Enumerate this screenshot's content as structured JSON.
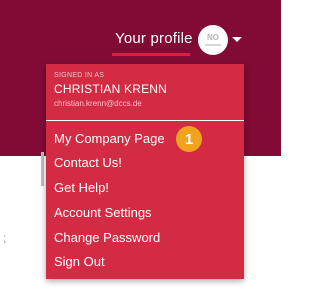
{
  "header": {
    "profile_label": "Your profile",
    "avatar_initials": "NO",
    "band_color": "#820b36",
    "accent_color": "#d9203f"
  },
  "dropdown": {
    "signed_in_label": "SIGNED IN AS",
    "user_name": "CHRISTIAN KRENN",
    "user_email": "christian.krenn@dccs.de",
    "background_color": "#d32b44",
    "items": [
      {
        "label": "My Company Page"
      },
      {
        "label": "Contact Us!"
      },
      {
        "label": "Get Help!"
      },
      {
        "label": "Account Settings"
      },
      {
        "label": "Change Password"
      },
      {
        "label": "Sign Out"
      }
    ]
  },
  "annotation": {
    "badge_number": "1",
    "badge_color": "#f0a31c"
  },
  "page": {
    "stray_text": ";"
  }
}
